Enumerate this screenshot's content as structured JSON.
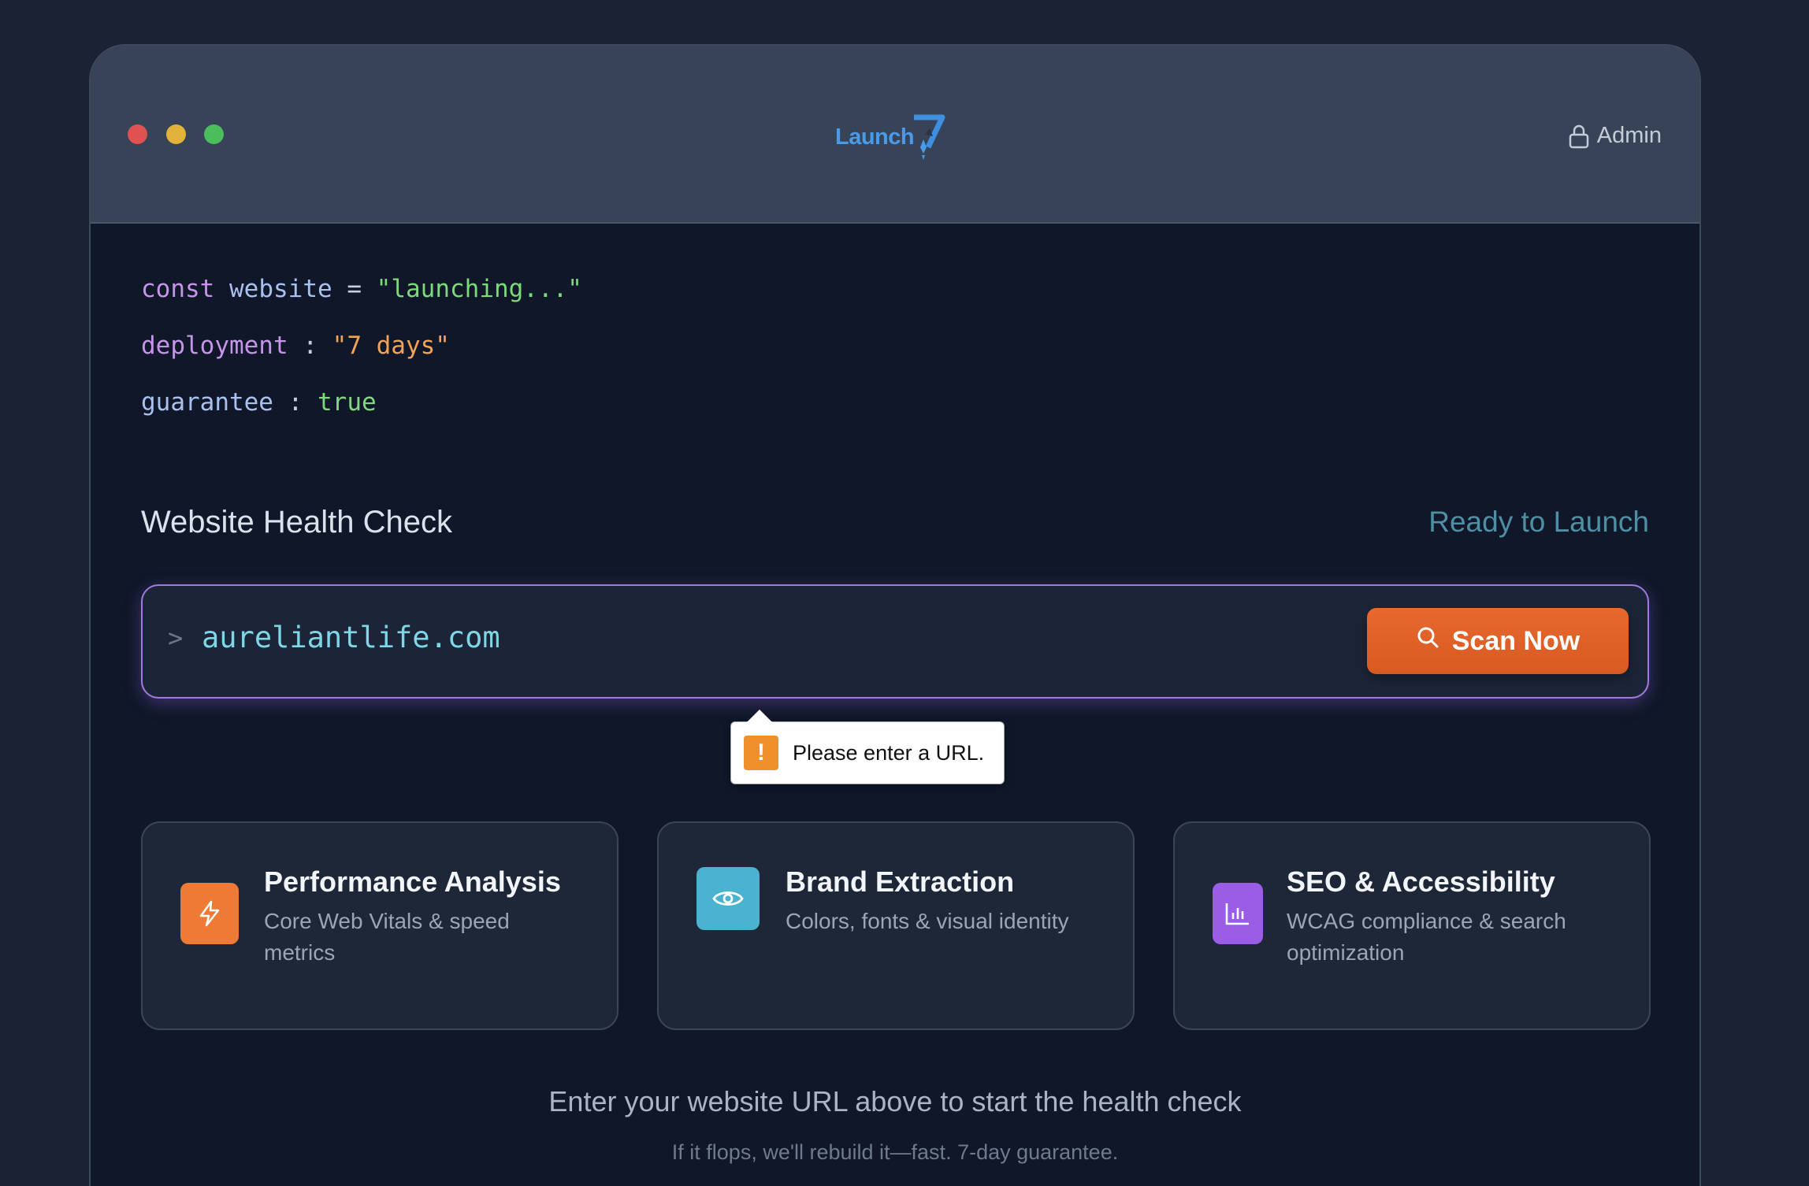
{
  "window": {
    "controls": [
      "close",
      "minimize",
      "maximize"
    ]
  },
  "header": {
    "logo_text": "Launch",
    "logo_mark": "7",
    "admin_label": "Admin",
    "admin_icon": "lock-icon"
  },
  "code": {
    "line1": {
      "keyword": "const",
      "name": "website",
      "op": "=",
      "value": "\"launching...\""
    },
    "line2": {
      "name": "deployment",
      "op": ":",
      "value": "\"7 days\""
    },
    "line3": {
      "name": "guarantee",
      "op": ":",
      "value": "true"
    }
  },
  "health_check": {
    "title": "Website Health Check",
    "status": "Ready to Launch",
    "prompt": ">",
    "url_value": "aureliantlife.com",
    "scan_button": "Scan Now",
    "scan_icon": "search-icon",
    "validation_message": "Please enter a URL."
  },
  "features": [
    {
      "title": "Performance Analysis",
      "desc_line1": "Core Web Vitals & speed",
      "desc_line2": "metrics",
      "icon": "lightning-icon",
      "color": "#ee7a35"
    },
    {
      "title": "Brand Extraction",
      "desc_line1": "Colors, fonts & visual identity",
      "desc_line2": "",
      "icon": "eye-icon",
      "color": "#4bb3cf"
    },
    {
      "title": "SEO & Accessibility",
      "desc_line1": "WCAG compliance & search",
      "desc_line2": "optimization",
      "icon": "bar-chart-icon",
      "color": "#9b5de5"
    }
  ],
  "footer": {
    "main": "Enter your website URL above to start the health check",
    "sub": "If it flops, we'll rebuild it—fast. 7-day guarantee."
  },
  "colors": {
    "accent": "#e8692e",
    "input_border": "#a07ae0",
    "url_text": "#7fd6e6"
  }
}
